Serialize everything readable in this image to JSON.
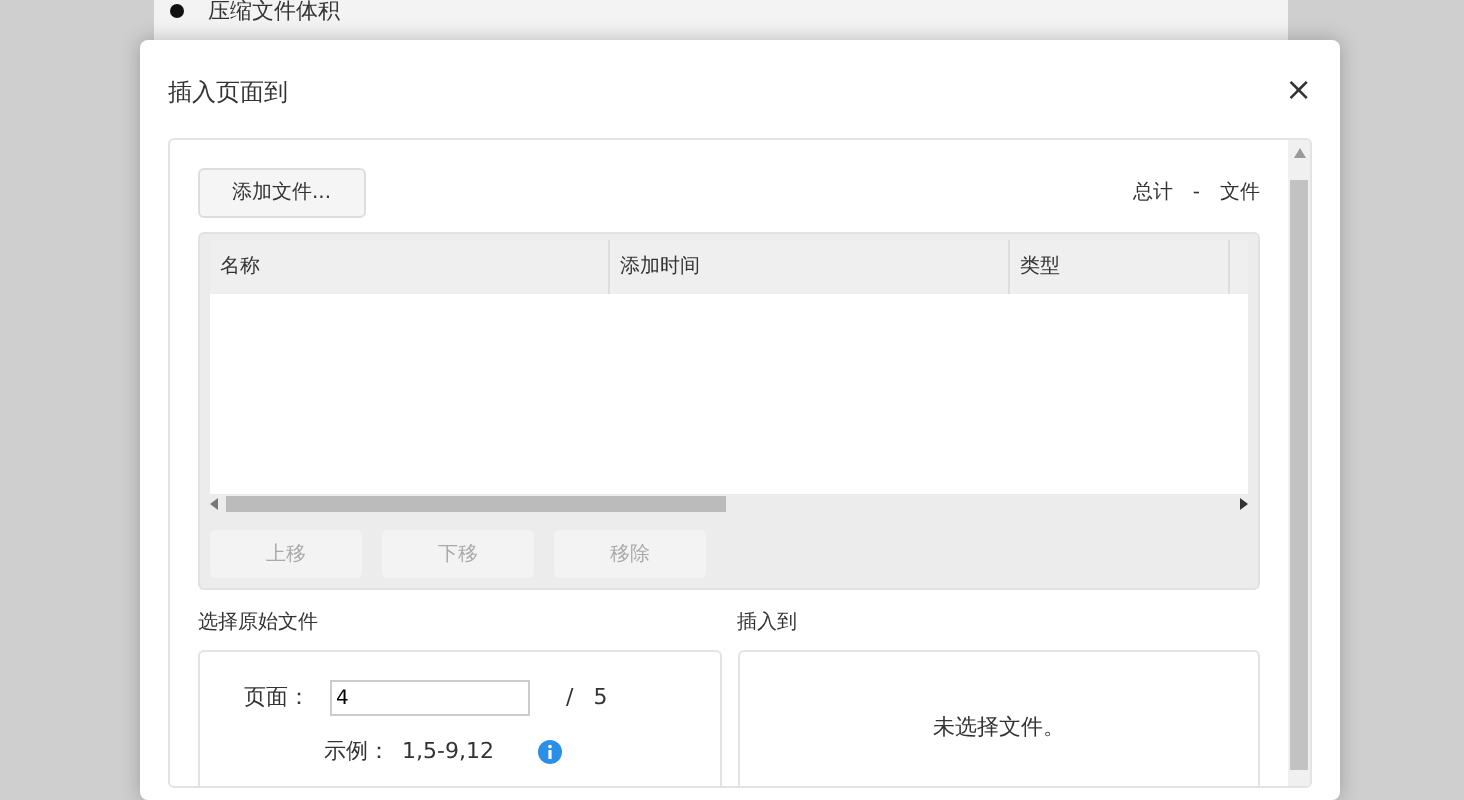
{
  "background_page": {
    "bullet_item": "压缩文件体积"
  },
  "dialog": {
    "title": "插入页面到",
    "close": "×",
    "add_button": "添加文件...",
    "total": {
      "label": "总计",
      "count": "-",
      "unit": "文件"
    },
    "table": {
      "columns": [
        "名称",
        "添加时间",
        "类型"
      ]
    },
    "row_buttons": [
      {
        "label": "上移",
        "disabled": true
      },
      {
        "label": "下移",
        "disabled": true
      },
      {
        "label": "移除",
        "disabled": true
      }
    ],
    "source": {
      "heading": "选择原始文件",
      "page_label": "页面：",
      "page_value": "4",
      "separator": "/",
      "page_total": "5",
      "example_label": "示例：",
      "example_value": "1,5-9,12"
    },
    "target": {
      "heading": "插入到",
      "message": "未选择文件。"
    }
  }
}
